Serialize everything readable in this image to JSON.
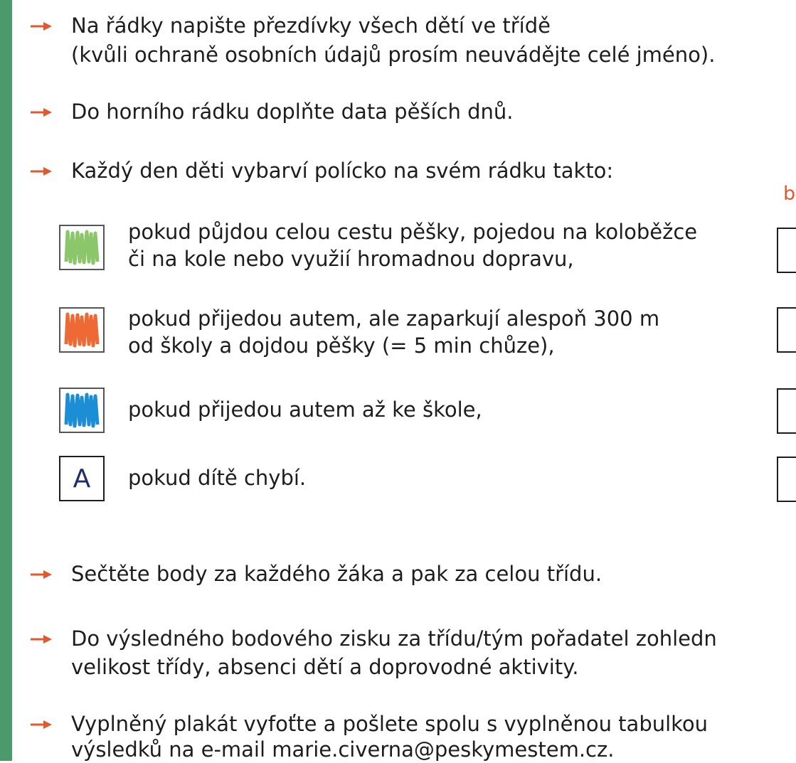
{
  "instructions": {
    "step1_line1": "Na řádky napište přezdívky všech dětí ve třídě",
    "step1_line2": "(kvůli ochraně osobních údajů prosím neuvádějte celé jméno).",
    "step2": "Do horního rádku doplňte data pěších dnů.",
    "step3": "Každý den děti vybarví polícko na svém rádku takto:",
    "step4": "Sečtěte body za každého žáka a pak za celou třídu.",
    "step5_line1": "Do výsledného bodového zisku za třídu/tým pořadatel zohledn",
    "step5_line2": "velikost třídy, absenci dětí a doprovodné aktivity.",
    "step6_line1": "Vyplněný plakát vyfoťte a pošlete spolu s vyplněnou tabulkou",
    "step6_line2": "výsledků na e-mail marie.civerna@peskymestem.cz."
  },
  "legend": {
    "green_line1": "pokud půjdou celou cestu pěšky, pojedou na koloběžce",
    "green_line2": "či na kole nebo využií hromadnou dopravu,",
    "orange_line1": "pokud přijedou autem, ale zaparkují alespoň 300 m",
    "orange_line2": "od školy a dojdou pěšky (= 5 min chůze),",
    "blue_line1": "pokud přijedou autem až ke škole,",
    "absent_letter": "A",
    "absent_line1": "pokud dítě chybí."
  },
  "points_header": "b",
  "colors": {
    "sidebar": "#4c9a6b",
    "arrow": "#e2582d",
    "green": "#8cc66a",
    "orange": "#ee6a35",
    "blue": "#1b8ed6",
    "letter": "#1d2f66"
  }
}
